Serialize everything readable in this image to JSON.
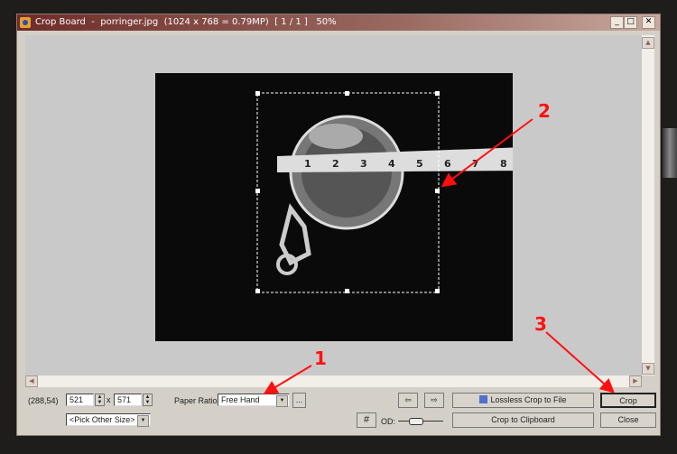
{
  "window": {
    "title": "Crop Board  -  porringer.jpg  (1024 x 768 = 0.79MP)  [ 1 / 1 ]   50%",
    "minimize": "_",
    "maximize": "□",
    "close": "✕"
  },
  "controls": {
    "coords": "(288,54)",
    "width": "521",
    "times": "x",
    "height": "571",
    "pick_size": "<Pick Other Size>",
    "paper_ratio_label": "Paper Ratio:",
    "paper_ratio": "Free Hand",
    "more": "...",
    "prev": "⇦",
    "next": "⇨",
    "grid": "#",
    "od_label": "OD:",
    "lossless": "Lossless Crop to File",
    "crop": "Crop",
    "clipboard": "Crop to Clipboard",
    "close": "Close"
  },
  "annotations": {
    "a1": "1",
    "a2": "2",
    "a3": "3",
    "color": "#ff1010"
  },
  "ruler": {
    "marks": [
      "1",
      "2",
      "3",
      "4",
      "5",
      "6",
      "7",
      "8"
    ]
  }
}
